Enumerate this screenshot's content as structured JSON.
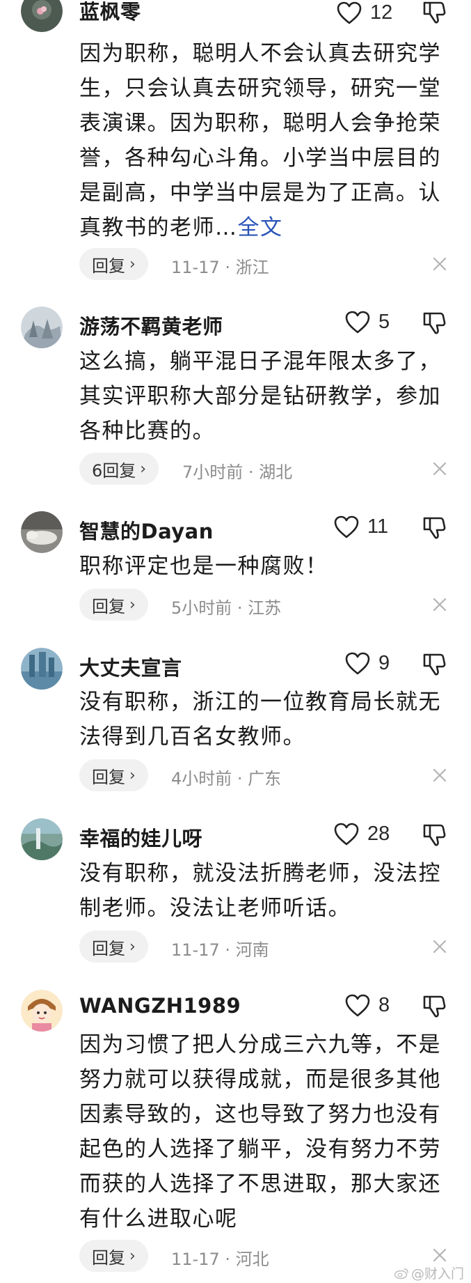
{
  "colors": {
    "link": "#2a55b8",
    "meta": "#8c8c8c",
    "pill_bg": "#f1f1f1"
  },
  "comments": [
    {
      "username": "蓝枫零",
      "likes": "12",
      "text": "因为职称，聪明人不会认真去研究学生，只会认真去研究领导，研究一堂表演课。因为职称，聪明人会争抢荣誉，各种勾心斗角。小学当中层目的是副高，中学当中层是为了正高。认真教书的老师…",
      "full_text_link": "全文",
      "reply_label": "回复",
      "time": "11-17",
      "location": "浙江"
    },
    {
      "username": "游荡不羁黄老师",
      "likes": "5",
      "text": "这么搞，躺平混日子混年限太多了，其实评职称大部分是钻研教学，参加各种比赛的。",
      "reply_label": "6回复",
      "time": "7小时前",
      "location": "湖北"
    },
    {
      "username": "智慧的Dayan",
      "likes": "11",
      "text": "职称评定也是一种腐败！",
      "reply_label": "回复",
      "time": "5小时前",
      "location": "江苏"
    },
    {
      "username": "大丈夫宣言",
      "likes": "9",
      "text": "没有职称，浙江的一位教育局长就无法得到几百名女教师。",
      "reply_label": "回复",
      "time": "4小时前",
      "location": "广东"
    },
    {
      "username": "幸福的娃儿呀",
      "likes": "28",
      "text": "没有职称，就没法折腾老师，没法控制老师。没法让老师听话。",
      "reply_label": "回复",
      "time": "11-17",
      "location": "河南"
    },
    {
      "username": "WANGZH1989",
      "likes": "8",
      "text": "因为习惯了把人分成三六九等，不是努力就可以获得成就，而是很多其他因素导致的，这也导致了努力也没有起色的人选择了躺平，没有努力不劳而获的人选择了不思进取，那大家还有什么进取心呢",
      "reply_label": "回复",
      "time": "11-17",
      "location": "河北"
    }
  ],
  "watermark": "@财入门"
}
